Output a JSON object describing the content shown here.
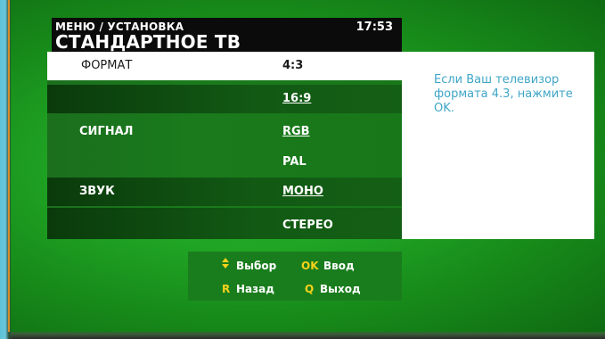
{
  "header": {
    "breadcrumb": "МЕНЮ / УСТАНОВКА",
    "title": "СТАНДАРТНОЕ ТВ",
    "time": "17:53"
  },
  "menu": {
    "rows": [
      {
        "label": "ФОРМАТ",
        "value": "4:3"
      },
      {
        "label": "",
        "value": "16:9"
      },
      {
        "label": "СИГНАЛ",
        "value": "RGB"
      },
      {
        "label": "",
        "value": "PAL"
      },
      {
        "label": "ЗВУК",
        "value": "МОНО"
      },
      {
        "label": "",
        "value": "СТЕРЕО"
      }
    ]
  },
  "info": {
    "text": "Если Ваш телевизор формата 4.3, нажмите OK."
  },
  "hints": {
    "select_label": "Выбор",
    "ok_key": "OK",
    "ok_label": "Ввод",
    "back_key": "R",
    "back_label": "Назад",
    "exit_key": "Q",
    "exit_label": "Выход"
  },
  "colors": {
    "screen_green": "#20a524",
    "panel_green": "#1a7a1c",
    "hint_key": "#f6d21b",
    "info_text": "#3fa6c6"
  }
}
